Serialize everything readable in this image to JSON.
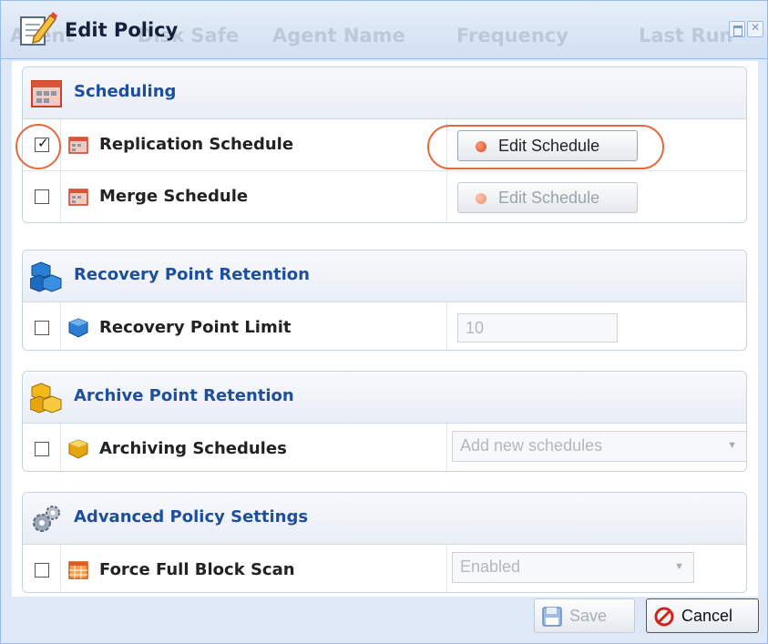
{
  "window": {
    "title": "Edit Policy",
    "background_headers": [
      "Agent",
      "Disk Safe",
      "Agent Name",
      "Frequency",
      "Last Run"
    ]
  },
  "sections": [
    {
      "title": "Scheduling",
      "icon": "calendar-icon",
      "rows": [
        {
          "label": "Replication Schedule",
          "checked": true,
          "icon": "calendar-icon",
          "control": "button",
          "value": "Edit Schedule",
          "enabled": true
        },
        {
          "label": "Merge Schedule",
          "checked": false,
          "icon": "calendar-icon",
          "control": "button",
          "value": "Edit Schedule",
          "enabled": false
        }
      ]
    },
    {
      "title": "Recovery Point Retention",
      "icon": "blue-cubes-icon",
      "rows": [
        {
          "label": "Recovery Point Limit",
          "checked": false,
          "icon": "blue-cube-icon",
          "control": "text",
          "value": "10",
          "enabled": false
        }
      ]
    },
    {
      "title": "Archive Point Retention",
      "icon": "gold-cubes-icon",
      "rows": [
        {
          "label": "Archiving Schedules",
          "checked": false,
          "icon": "gold-cube-icon",
          "control": "select",
          "value": "Add new schedules",
          "enabled": false
        }
      ]
    },
    {
      "title": "Advanced Policy Settings",
      "icon": "gears-icon",
      "rows": [
        {
          "label": "Force Full Block Scan",
          "checked": false,
          "icon": "table-icon",
          "control": "select",
          "value": "Enabled",
          "enabled": false
        }
      ]
    }
  ],
  "footer": {
    "save_label": "Save",
    "cancel_label": "Cancel"
  },
  "colors": {
    "section_title": "#1e4f9c",
    "highlight": "#e46a3d",
    "dialog_bg": "#dfe8f6"
  }
}
